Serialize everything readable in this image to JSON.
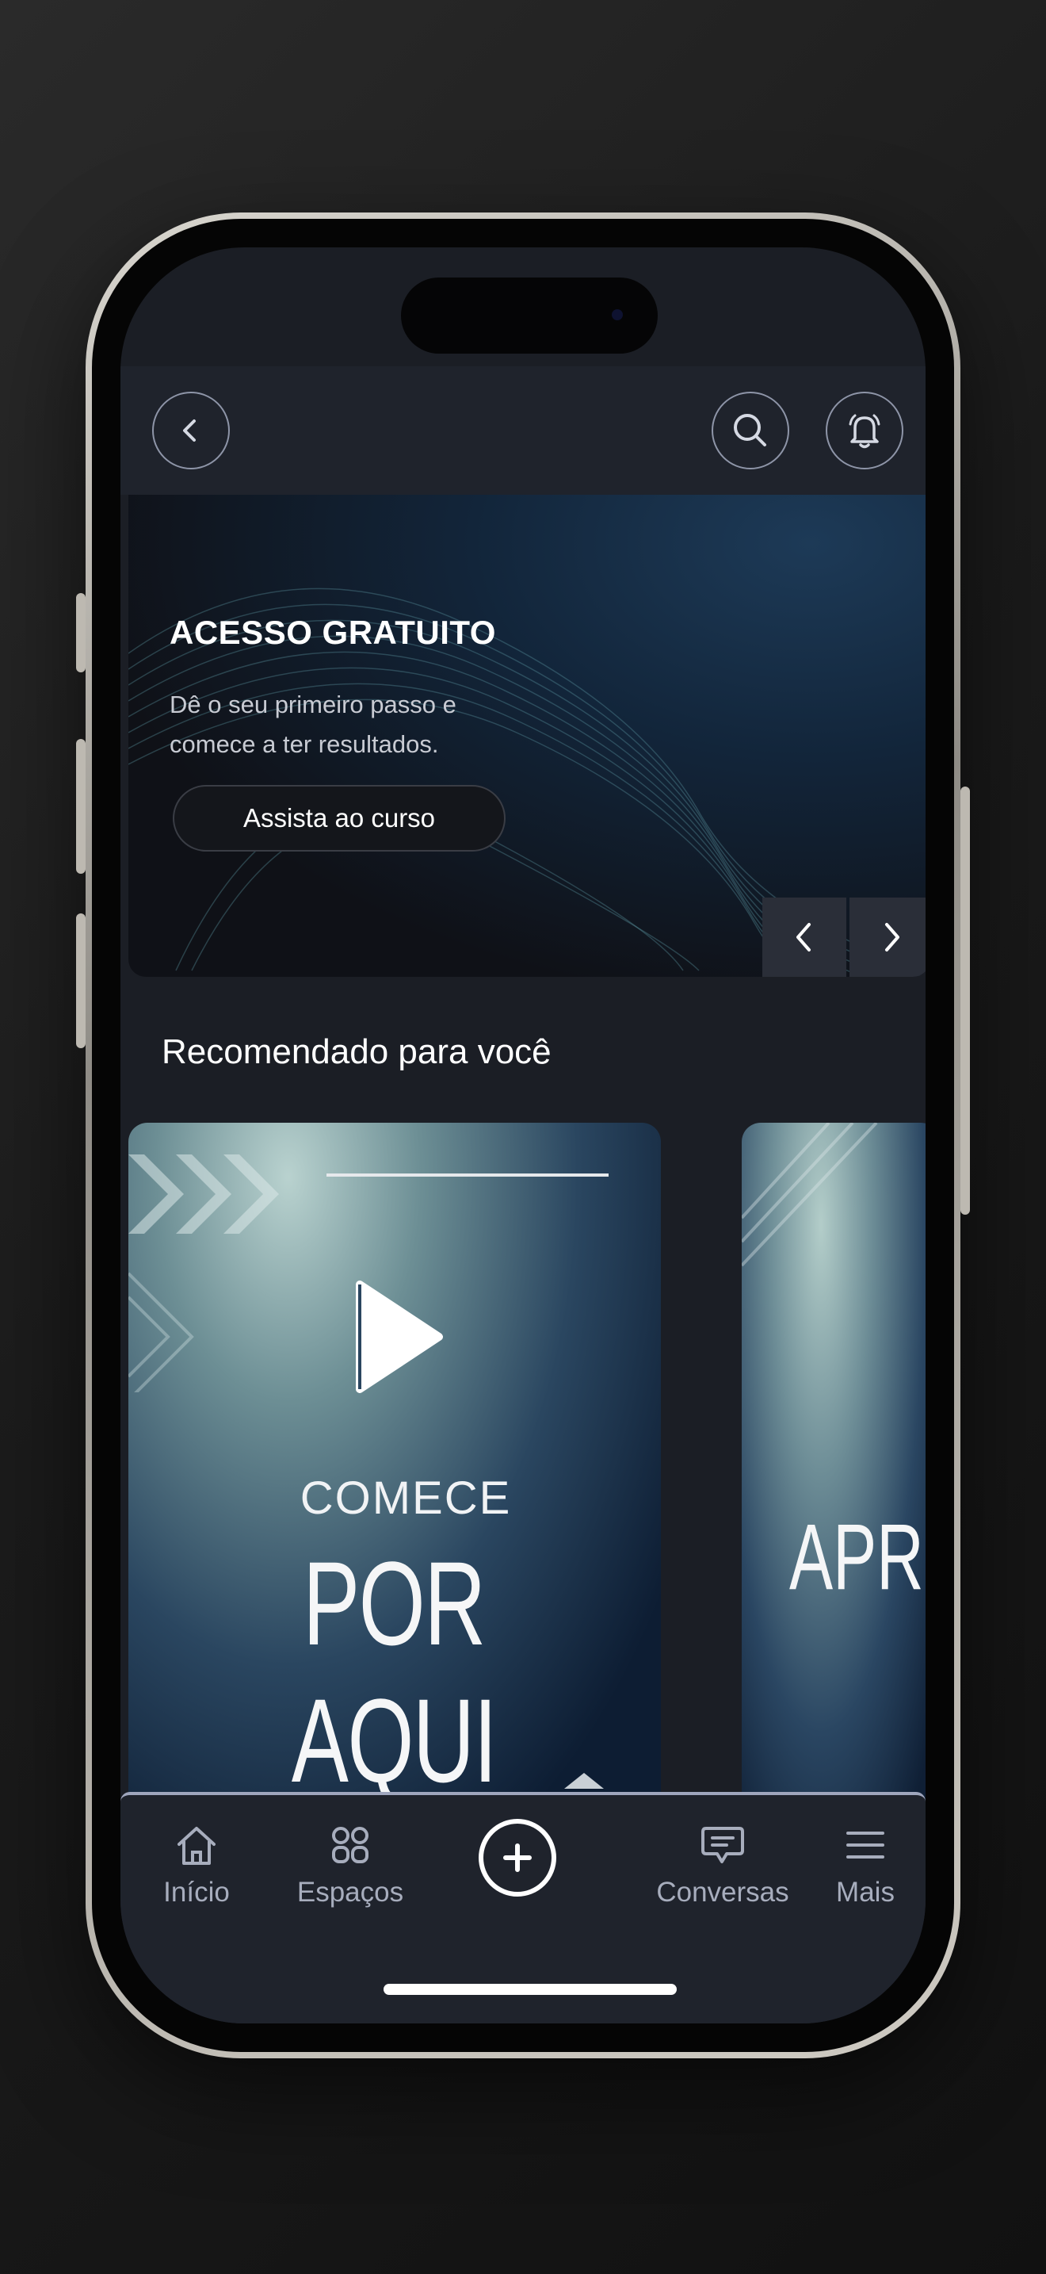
{
  "banner": {
    "title": "ACESSO GRATUITO",
    "subtitle_line1": "Dê o seu primeiro passo e",
    "subtitle_line2": "comece a ter resultados.",
    "cta": "Assista ao curso"
  },
  "recommended": {
    "title": "Recomendado para você",
    "cards": [
      {
        "small": "COMECE",
        "big": "POR AQUI"
      },
      {
        "big": "APRE"
      }
    ]
  },
  "tabs": [
    {
      "label": "Início",
      "icon": "home-icon"
    },
    {
      "label": "Espaços",
      "icon": "grid-icon"
    },
    {
      "label": "",
      "icon": "plus-circle-icon"
    },
    {
      "label": "Conversas",
      "icon": "chat-icon"
    },
    {
      "label": "Mais",
      "icon": "menu-icon"
    }
  ],
  "colors": {
    "background": "#1b1e25",
    "bar": "#1f232c",
    "tab_text": "#a7adbd",
    "accent_line": "#9fa6bd"
  }
}
